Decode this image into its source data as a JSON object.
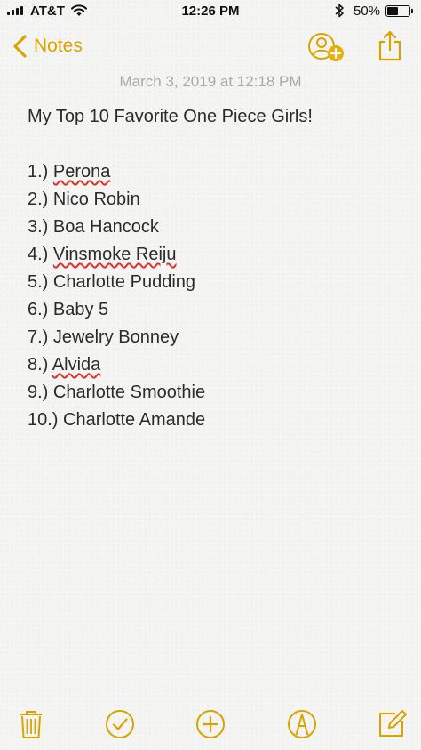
{
  "status_bar": {
    "carrier": "AT&T",
    "time": "12:26 PM",
    "battery_percent": "50%",
    "battery_level": 0.5
  },
  "nav": {
    "back_label": "Notes",
    "accent": "#d9a400"
  },
  "note": {
    "date": "March 3, 2019 at 12:18 PM",
    "title": "My Top 10 Favorite One Piece Girls!",
    "items": [
      {
        "num": "1.) ",
        "name": "Perona",
        "misspelled": true
      },
      {
        "num": "2.) ",
        "name": "Nico Robin",
        "misspelled": false
      },
      {
        "num": "3.) ",
        "name": "Boa Hancock",
        "misspelled": false
      },
      {
        "num": "4.) ",
        "name": "Vinsmoke Reiju",
        "misspelled": true
      },
      {
        "num": "5.) ",
        "name": "Charlotte Pudding",
        "misspelled": false
      },
      {
        "num": "6.) ",
        "name": "Baby 5",
        "misspelled": false
      },
      {
        "num": "7.) ",
        "name": "Jewelry Bonney",
        "misspelled": false
      },
      {
        "num": "8.) ",
        "name": "Alvida",
        "misspelled": true
      },
      {
        "num": "9.) ",
        "name": "Charlotte Smoothie",
        "misspelled": false
      },
      {
        "num": "10.) ",
        "name": "Charlotte Amande",
        "misspelled": false
      }
    ]
  },
  "toolbar": {
    "icons": [
      "trash-icon",
      "checklist-icon",
      "add-icon",
      "markup-icon",
      "compose-icon"
    ]
  }
}
